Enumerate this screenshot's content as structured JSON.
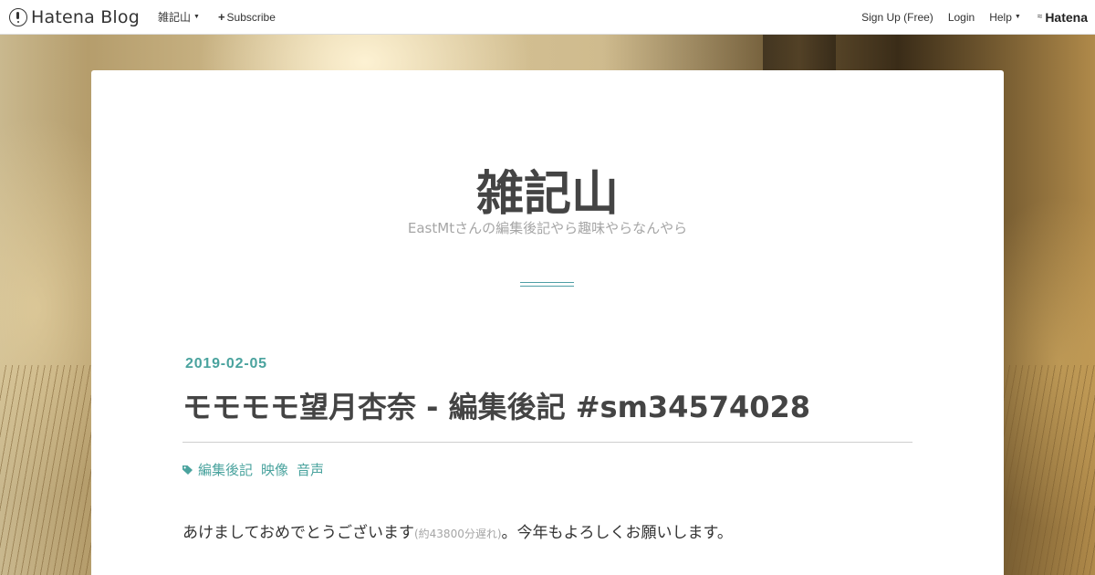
{
  "globalheader": {
    "logo_text": "Hatena Blog",
    "blog_menu_label": "雑記山",
    "subscribe_label": "Subscribe",
    "signup_label": "Sign Up (Free)",
    "login_label": "Login",
    "help_label": "Help",
    "brand_label": "Hatena"
  },
  "blog": {
    "title": "雑記山",
    "description": "EastMtさんの編集後記やら趣味やらなんやら"
  },
  "entry": {
    "date": "2019-02-05",
    "title": "モモモモ望月杏奈 - 編集後記 #sm34574028",
    "categories": [
      "編集後記",
      "映像",
      "音声"
    ],
    "body_main": "あけましておめでとうございます",
    "body_note": "(約43800分遅れ)",
    "body_rest": "。今年もよろしくお願いします。"
  },
  "colors": {
    "accent": "#4aa39e",
    "title_text": "#444444",
    "muted_text": "#a6a6a6"
  },
  "icons": {
    "logo": "hatena-blog-logo-icon",
    "subscribe": "plus-icon",
    "category": "tag-icon"
  }
}
